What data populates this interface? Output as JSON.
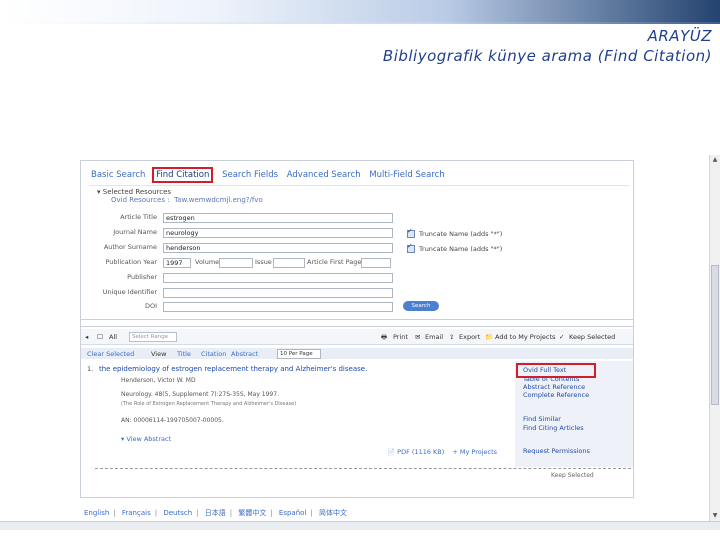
{
  "slide": {
    "title": "ARAYÜZ",
    "subtitle": "Bibliyografik künye arama (Find Citation)"
  },
  "ovid": {
    "tabs": [
      "Basic Search",
      "Find Citation",
      "Search Fields",
      "Advanced Search",
      "Multi-Field Search"
    ],
    "selected_resources": "Selected Resources",
    "resources_line": "Ovid Resources :",
    "resources_detail": "Taw.wemwdcmjl.eng?/fvo",
    "fields": [
      {
        "label": "Article Title",
        "value": "estrogen"
      },
      {
        "label": "Journal Name",
        "value": "neurology"
      },
      {
        "label": "Author Surname",
        "value": "henderson"
      }
    ],
    "truncate1": "Truncate Name (adds \"*\")",
    "truncate2": "Truncate Name (adds \"*\")",
    "pubrow": {
      "year_label": "Publication Year",
      "year_value": "1997",
      "volume": "Volume",
      "issue": "Issue",
      "page": "Article First Page"
    },
    "extra_fields": [
      "Publisher",
      "Unique Identifier",
      "DOI"
    ],
    "search_button": "Search"
  },
  "results": {
    "toolbar": {
      "all": "All",
      "select_range": "Select Range",
      "print": "Print",
      "email": "Email",
      "export": "Export",
      "add_projects": "Add to My Projects",
      "keep_selected": "Keep Selected"
    },
    "bar2": {
      "clear": "Clear Selected",
      "view": "View",
      "title": "Title",
      "citation": "Citation",
      "abstract": "Abstract",
      "per_page": "10 Per Page"
    },
    "item": {
      "number": "1.",
      "title": "the epidemiology of estrogen replacement therapy and Alzheimer's disease.",
      "author": "Henderson, Victor W. MD",
      "source": "Neurology. 48(5, Supplement 7):27S-35S, May 1997.",
      "source_note": "(The Role of Estrogen Replacement Therapy and Alzheimer's Disease)",
      "an": "AN: 00006114-199705007-00005.",
      "view_abstract": "View Abstract",
      "pdf": "PDF (1116 KB)",
      "my_projects": "+ My Projects"
    },
    "links": [
      "Ovid Full Text",
      "Table of Contents",
      "Abstract Reference",
      "Complete Reference",
      "Find Similar",
      "Find Citing Articles",
      "Request Permissions"
    ],
    "keep_selected_bottom": "Keep Selected"
  },
  "languages": [
    "English",
    "Français",
    "Deutsch",
    "日本語",
    "繁體中文",
    "Español",
    "简体中文"
  ]
}
